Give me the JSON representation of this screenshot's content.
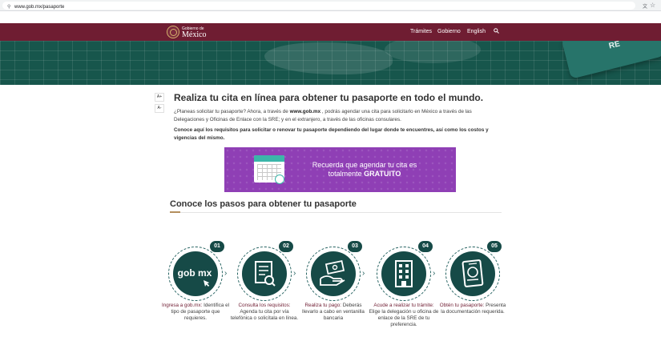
{
  "browser": {
    "url": "www.gob.mx/pasaporte"
  },
  "header": {
    "logo_small": "Gobierno de",
    "logo_big": "México",
    "nav": [
      "Trámites",
      "Gobierno",
      "English"
    ]
  },
  "hero": {
    "card_text": "RE"
  },
  "font_controls": [
    "A+",
    "A-"
  ],
  "main": {
    "title": "Realiza tu cita en línea para obtener tu pasaporte en todo el mundo.",
    "intro_before": "¿Planeas solicitar tu pasaporte? Ahora, a través de ",
    "intro_link": "www.gob.mx",
    "intro_after": " , podrás agendar una cita para solicitarlo en México a través de las Delegaciones y Oficinas de Enlace con la SRE; y en el extranjero, a través de las oficinas consulares.",
    "note": "Conoce aquí los requisitos para solicitar o renovar tu pasaporte dependiendo del lugar donde te encuentres, así como los costos y vigencias del mismo."
  },
  "banner": {
    "line1": "Recuerda que agendar tu cita es",
    "line2_before": "totalmente ",
    "line2_free": "GRATUITO"
  },
  "steps_section": {
    "title": "Conoce los pasos para obtener tu pasaporte",
    "steps": [
      {
        "number": "01",
        "icon": "gob-mx-click-icon",
        "icon_text": "gob mx",
        "lead": "Ingresa a gob.mx:",
        "text": " Identifica el tipo de pasaporte que requieres."
      },
      {
        "number": "02",
        "icon": "document-search-icon",
        "lead": "Consulta los requisitos:",
        "text": " Agenda tu cita por vía telefónica o solicítala en línea."
      },
      {
        "number": "03",
        "icon": "money-hand-icon",
        "lead": "Realiza tu pago:",
        "text": " Deberás llevarlo a cabo en ventanilla bancaria"
      },
      {
        "number": "04",
        "icon": "building-icon",
        "lead": "Acude a realizar tu trámite:",
        "text": " Elige la delegación u oficina de enlace de la SRE de tu preferencia."
      },
      {
        "number": "05",
        "icon": "passport-icon",
        "lead": "Obtén tu pasaporte:",
        "text": " Presenta la documentación requerida."
      }
    ]
  },
  "colors": {
    "navbar": "#6f1d32",
    "hero": "#17564c",
    "banner": "#8f3fb5",
    "step_disc": "#164a47",
    "accent_gold": "#b38e5d"
  }
}
